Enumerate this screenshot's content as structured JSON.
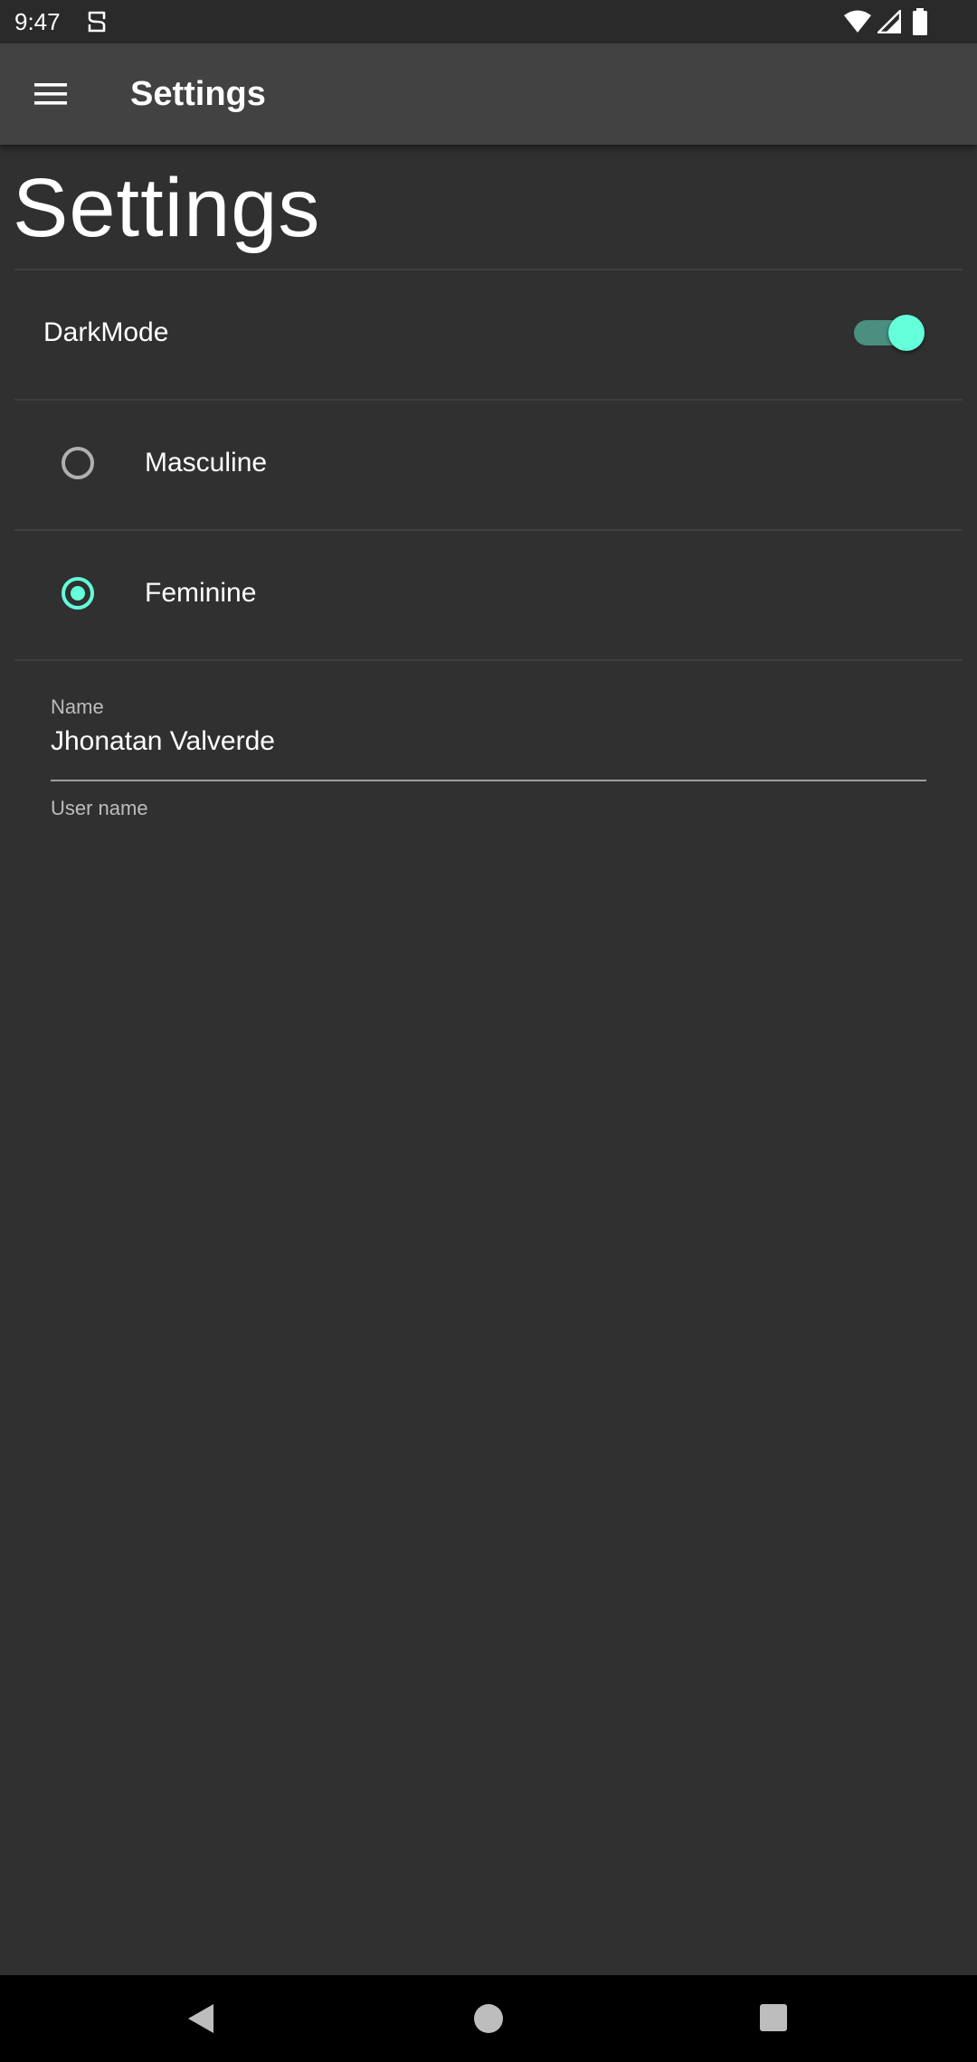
{
  "status_bar": {
    "time": "9:47",
    "notification_icon": "notification-app-icon",
    "wifi_icon": "wifi-icon",
    "signal_icon": "cell-signal-icon",
    "battery_icon": "battery-full-icon"
  },
  "app_bar": {
    "menu_icon": "hamburger-menu-icon",
    "title": "Settings"
  },
  "page": {
    "heading": "Settings"
  },
  "dark_mode": {
    "label": "DarkMode",
    "enabled": true
  },
  "gender": {
    "options": [
      {
        "label": "Masculine",
        "selected": false
      },
      {
        "label": "Feminine",
        "selected": true
      }
    ]
  },
  "name_field": {
    "label": "Name",
    "value": "Jhonatan Valverde",
    "helper": "User name"
  },
  "nav_bar": {
    "back_icon": "back-triangle-icon",
    "home_icon": "home-circle-icon",
    "recents_icon": "recents-square-icon"
  },
  "colors": {
    "background": "#303030",
    "app_bar": "#424242",
    "accent": "#64ffda",
    "switch_track": "#4a8f80"
  }
}
